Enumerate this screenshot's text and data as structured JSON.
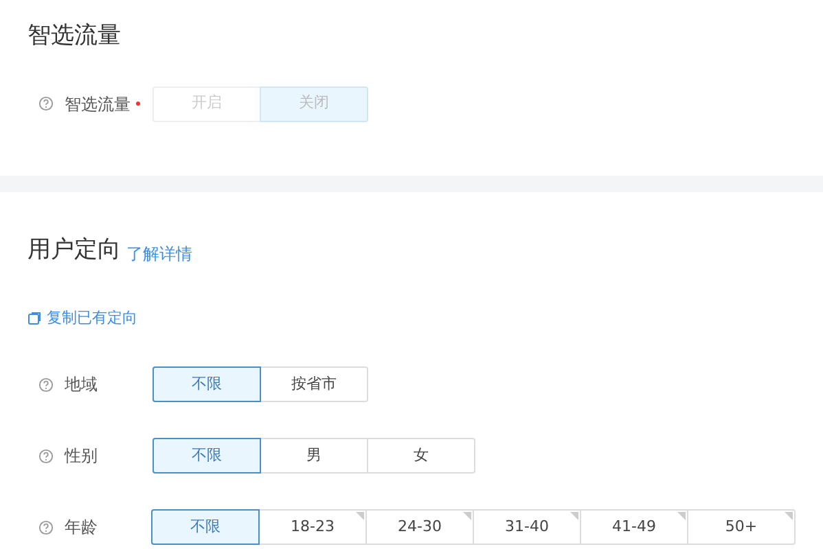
{
  "smart_traffic": {
    "title": "智选流量",
    "field": {
      "label": "智选流量",
      "required": true,
      "disabled": true,
      "options": [
        {
          "label": "开启",
          "selected": false,
          "marked": false
        },
        {
          "label": "关闭",
          "selected": true,
          "marked": false
        }
      ]
    }
  },
  "targeting": {
    "title": "用户定向",
    "link": "了解详情",
    "copy_link": "复制已有定向",
    "fields": [
      {
        "label": "地域",
        "required": false,
        "disabled": false,
        "options": [
          {
            "label": "不限",
            "selected": true,
            "marked": false
          },
          {
            "label": "按省市",
            "selected": false,
            "marked": false
          }
        ]
      },
      {
        "label": "性别",
        "required": false,
        "disabled": false,
        "options": [
          {
            "label": "不限",
            "selected": true,
            "marked": false
          },
          {
            "label": "男",
            "selected": false,
            "marked": false
          },
          {
            "label": "女",
            "selected": false,
            "marked": false
          }
        ]
      },
      {
        "label": "年龄",
        "required": false,
        "disabled": false,
        "options": [
          {
            "label": "不限",
            "selected": true,
            "marked": false
          },
          {
            "label": "18-23",
            "selected": false,
            "marked": true
          },
          {
            "label": "24-30",
            "selected": false,
            "marked": true
          },
          {
            "label": "31-40",
            "selected": false,
            "marked": true
          },
          {
            "label": "41-49",
            "selected": false,
            "marked": true
          },
          {
            "label": "50+",
            "selected": false,
            "marked": true
          }
        ]
      }
    ]
  }
}
